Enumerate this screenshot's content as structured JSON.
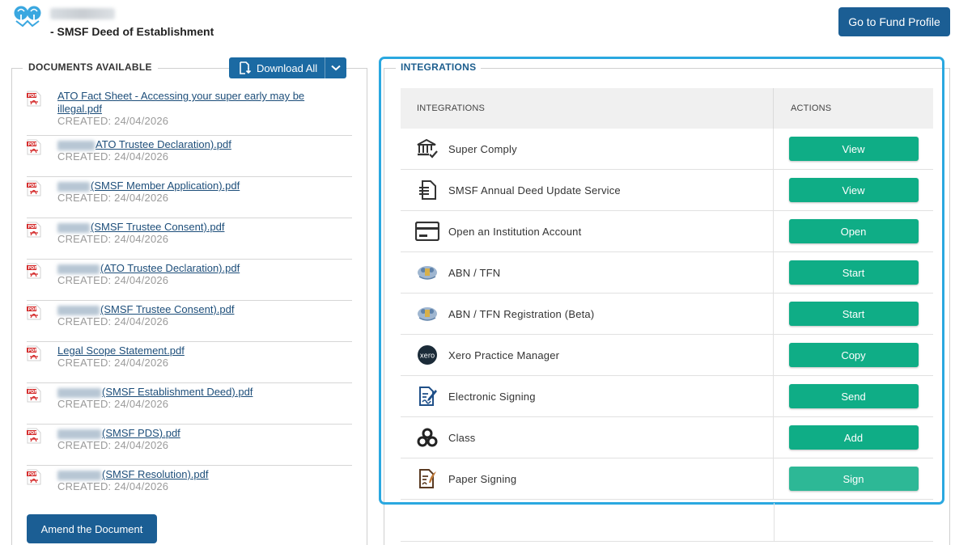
{
  "header": {
    "subtitle": "- SMSF Deed of Establishment",
    "fund_profile_button": "Go to Fund Profile"
  },
  "documents": {
    "legend": "DOCUMENTS AVAILABLE",
    "download_all_label": "Download All",
    "items": [
      {
        "name": "ATO Fact Sheet - Accessing your super early may be illegal.pdf",
        "date": "CREATED: 24/04/2026",
        "redacted": false
      },
      {
        "name": "ATO Trustee Declaration).pdf",
        "date": "CREATED: 24/04/2026",
        "redacted": true
      },
      {
        "name": "(SMSF Member Application).pdf",
        "date": "CREATED: 24/04/2026",
        "redacted": true
      },
      {
        "name": "(SMSF Trustee Consent).pdf",
        "date": "CREATED: 24/04/2026",
        "redacted": true
      },
      {
        "name": "(ATO Trustee Declaration).pdf",
        "date": "CREATED: 24/04/2026",
        "redacted": true
      },
      {
        "name": "(SMSF Trustee Consent).pdf",
        "date": "CREATED: 24/04/2026",
        "redacted": true
      },
      {
        "name": "Legal Scope Statement.pdf",
        "date": "CREATED: 24/04/2026",
        "redacted": false
      },
      {
        "name": "(SMSF Establishment Deed).pdf",
        "date": "CREATED: 24/04/2026",
        "redacted": true
      },
      {
        "name": "(SMSF PDS).pdf",
        "date": "CREATED: 24/04/2026",
        "redacted": true
      },
      {
        "name": "(SMSF Resolution).pdf",
        "date": "CREATED: 24/04/2026",
        "redacted": true
      }
    ],
    "amend_button": "Amend the Document"
  },
  "integrations": {
    "legend": "INTEGRATIONS",
    "col_integrations": "INTEGRATIONS",
    "col_actions": "ACTIONS",
    "rows": [
      {
        "name": "Super Comply",
        "action": "View",
        "icon": "bank-check-icon"
      },
      {
        "name": "SMSF Annual Deed Update Service",
        "action": "View",
        "icon": "document-icon"
      },
      {
        "name": "Open an Institution Account",
        "action": "Open",
        "icon": "card-icon"
      },
      {
        "name": "ABN / TFN",
        "action": "Start",
        "icon": "coat-of-arms-icon"
      },
      {
        "name": "ABN / TFN Registration (Beta)",
        "action": "Start",
        "icon": "coat-of-arms-icon"
      },
      {
        "name": "Xero Practice Manager",
        "action": "Copy",
        "icon": "xero-icon"
      },
      {
        "name": "Electronic Signing",
        "action": "Send",
        "icon": "e-sign-icon"
      },
      {
        "name": "Class",
        "action": "Add",
        "icon": "class-logo-icon"
      },
      {
        "name": "Paper Signing",
        "action": "Sign",
        "icon": "paper-sign-icon"
      }
    ]
  },
  "colors": {
    "primary": "#1b5e94",
    "action_green": "#0fad86",
    "highlight_border": "#2aa8e0"
  }
}
